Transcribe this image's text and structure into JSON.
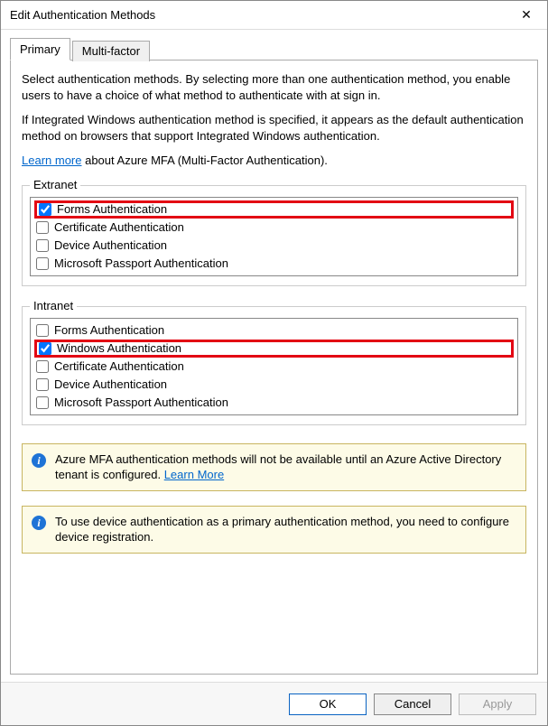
{
  "window": {
    "title": "Edit Authentication Methods",
    "close_glyph": "✕"
  },
  "tabs": {
    "primary": "Primary",
    "multifactor": "Multi-factor"
  },
  "intro": {
    "p1": "Select authentication methods. By selecting more than one authentication method, you enable users to have a choice of what method to authenticate with at sign in.",
    "p2": "If Integrated Windows authentication method is specified, it appears as the default authentication method on browsers that support Integrated Windows authentication.",
    "learn_more": "Learn more",
    "learn_more_tail": " about Azure MFA (Multi-Factor Authentication)."
  },
  "extranet": {
    "legend": "Extranet",
    "items": [
      {
        "label": "Forms Authentication",
        "checked": true,
        "highlight": true
      },
      {
        "label": "Certificate Authentication",
        "checked": false,
        "highlight": false
      },
      {
        "label": "Device Authentication",
        "checked": false,
        "highlight": false
      },
      {
        "label": "Microsoft Passport Authentication",
        "checked": false,
        "highlight": false
      }
    ]
  },
  "intranet": {
    "legend": "Intranet",
    "items": [
      {
        "label": "Forms Authentication",
        "checked": false,
        "highlight": false
      },
      {
        "label": "Windows Authentication",
        "checked": true,
        "highlight": true
      },
      {
        "label": "Certificate Authentication",
        "checked": false,
        "highlight": false
      },
      {
        "label": "Device Authentication",
        "checked": false,
        "highlight": false
      },
      {
        "label": "Microsoft Passport Authentication",
        "checked": false,
        "highlight": false
      }
    ]
  },
  "infos": {
    "mfa": {
      "text": "Azure MFA authentication methods will not be available until an Azure Active Directory tenant is configured. ",
      "link": "Learn More"
    },
    "device": {
      "text": "To use device authentication as a primary authentication method, you need to configure device registration."
    }
  },
  "buttons": {
    "ok": "OK",
    "cancel": "Cancel",
    "apply": "Apply"
  }
}
